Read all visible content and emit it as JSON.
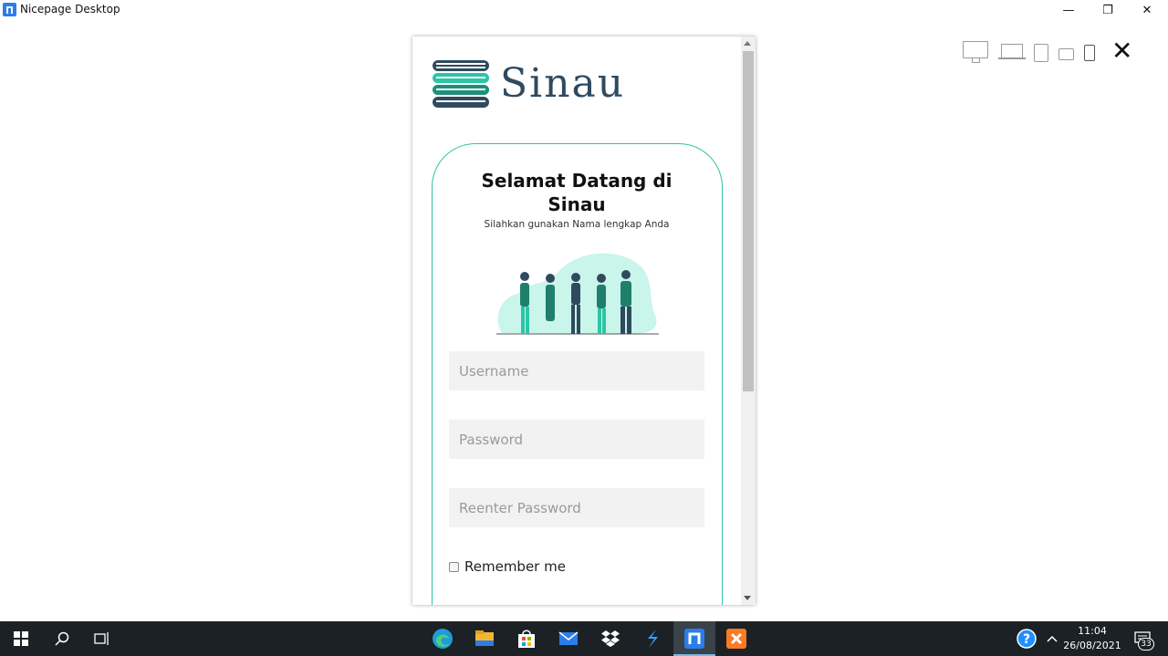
{
  "window": {
    "title": "Nicepage Desktop",
    "minimize_glyph": "—",
    "maximize_glyph": "❐",
    "close_glyph": "✕"
  },
  "preview_toolbar": {
    "devices": [
      "desktop-icon",
      "laptop-icon",
      "tablet-icon",
      "tablet-landscape-icon",
      "phone-icon"
    ],
    "active_device": "phone-icon",
    "close_glyph": "✕"
  },
  "page": {
    "brand_name": "Sinau",
    "heading": "Selamat Datang di Sinau",
    "subtitle": "Silahkan gunakan Nama lengkap Anda",
    "fields": {
      "username_placeholder": "Username",
      "password_placeholder": "Password",
      "reenter_placeholder": "Reenter Password"
    },
    "remember_label": "Remember me",
    "accent_color": "#2ec4a6",
    "brand_color": "#2f4a5f"
  },
  "taskbar": {
    "apps": [
      "start-icon",
      "search-icon",
      "task-view-icon",
      "edge-icon",
      "file-explorer-icon",
      "store-icon",
      "mail-icon",
      "dropbox-icon",
      "vscode-icon",
      "nicepage-icon",
      "xampp-icon"
    ],
    "active_app": "nicepage-icon",
    "time": "11:04",
    "date": "26/08/2021",
    "notification_count": "33"
  }
}
